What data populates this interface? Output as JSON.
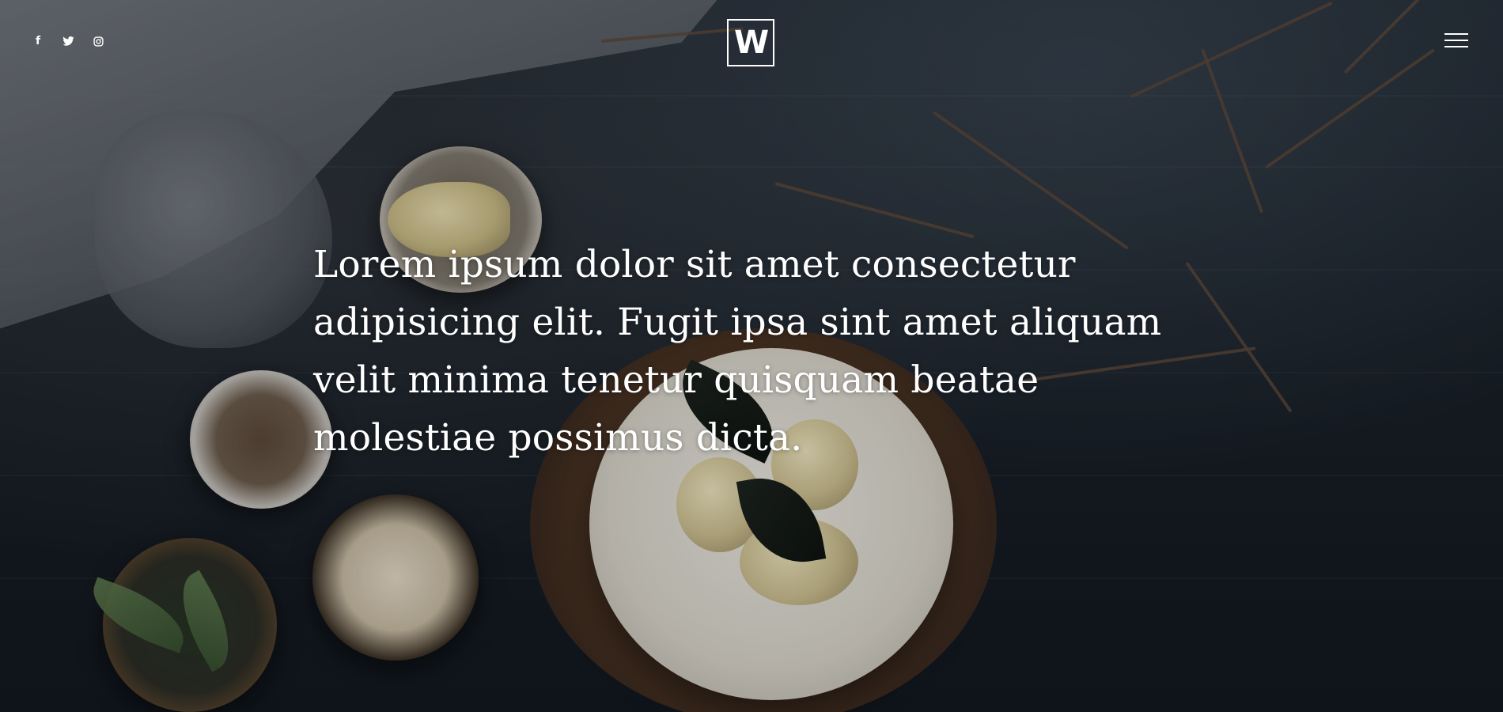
{
  "header": {
    "social": [
      {
        "icon": "facebook-icon",
        "glyph": "f"
      },
      {
        "icon": "twitter-icon",
        "glyph": ""
      },
      {
        "icon": "instagram-icon",
        "glyph": ""
      }
    ],
    "logo_letter": "W",
    "menu_icon": "hamburger-icon"
  },
  "hero": {
    "headline": "Lorem ipsum dolor sit amet consectetur adipisicing elit. Fugit ipsa sint amet aliquam velit minima tenetur quisquam beatae molestiae possimus dicta.",
    "background_subject": "food-photo",
    "colors": {
      "text": "#ffffff",
      "background": "#161c23"
    }
  }
}
